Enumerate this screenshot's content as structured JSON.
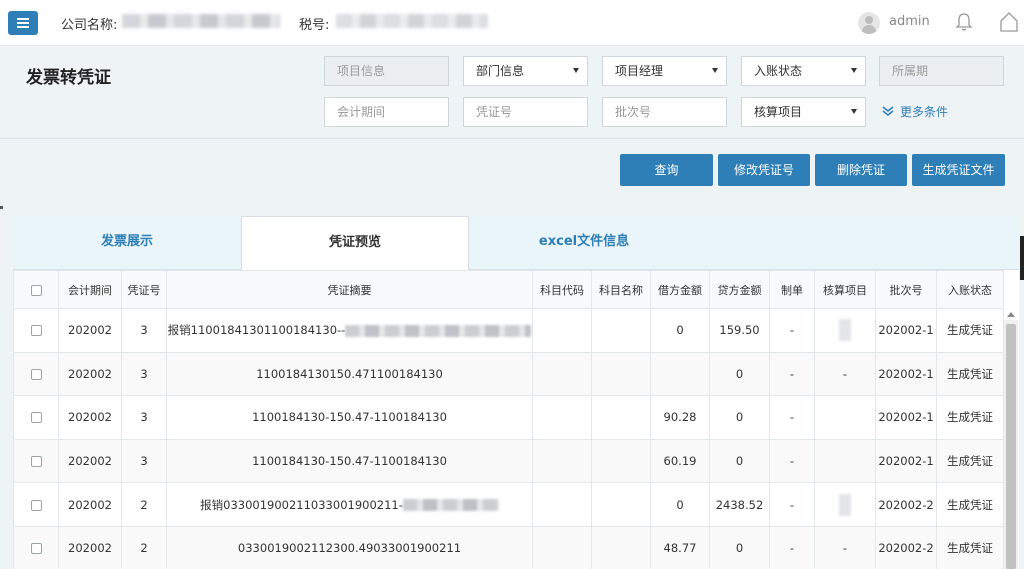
{
  "header": {
    "company_label": "公司名称:",
    "tax_label": "税号:",
    "user_name": "admin"
  },
  "page": {
    "title": "发票转凭证"
  },
  "filters": {
    "project_info": "项目信息",
    "department_info": "部门信息",
    "project_manager": "项目经理",
    "entry_status": "入账状态",
    "period": "所属期",
    "accounting_period": "会计期间",
    "voucher_no": "凭证号",
    "batch_no": "批次号",
    "accounting_item": "核算项目",
    "more_conditions": "更多条件"
  },
  "actions": {
    "query": "查询",
    "modify_voucher_no": "修改凭证号",
    "delete_voucher": "删除凭证",
    "generate_voucher_file": "生成凭证文件"
  },
  "tabs": [
    {
      "label": "发票展示"
    },
    {
      "label": "凭证预览"
    },
    {
      "label": "excel文件信息"
    }
  ],
  "table": {
    "columns": [
      "会计期间",
      "凭证号",
      "凭证摘要",
      "科目代码",
      "科目名称",
      "借方金额",
      "贷方金额",
      "制单",
      "核算项目",
      "批次号",
      "入账状态"
    ],
    "rows": [
      {
        "period": "202002",
        "voucher": "3",
        "summary": "报销11001841301100184130--",
        "code": "",
        "name": "",
        "debit": "0",
        "credit": "159.50",
        "maker": "-",
        "item": "",
        "batch": "202002-1",
        "status": "生成凭证"
      },
      {
        "period": "202002",
        "voucher": "3",
        "summary": "1100184130150.471100184130",
        "code": "",
        "name": "",
        "debit": "",
        "credit": "0",
        "maker": "-",
        "item": "-",
        "batch": "202002-1",
        "status": "生成凭证"
      },
      {
        "period": "202002",
        "voucher": "3",
        "summary": "1100184130-150.47-1100184130",
        "code": "",
        "name": "",
        "debit": "90.28",
        "credit": "0",
        "maker": "-",
        "item": "",
        "batch": "202002-1",
        "status": "生成凭证"
      },
      {
        "period": "202002",
        "voucher": "3",
        "summary": "1100184130-150.47-1100184130",
        "code": "",
        "name": "",
        "debit": "60.19",
        "credit": "0",
        "maker": "-",
        "item": "",
        "batch": "202002-1",
        "status": "生成凭证"
      },
      {
        "period": "202002",
        "voucher": "2",
        "summary": "报销03300190021103300190021​1-",
        "code": "",
        "name": "",
        "debit": "0",
        "credit": "2438.52",
        "maker": "-",
        "item": "",
        "batch": "202002-2",
        "status": "生成凭证"
      },
      {
        "period": "202002",
        "voucher": "2",
        "summary": "0330019002112300.49033001900211",
        "code": "",
        "name": "",
        "debit": "48.77",
        "credit": "0",
        "maker": "-",
        "item": "-",
        "batch": "202002-2",
        "status": "生成凭证"
      }
    ]
  }
}
